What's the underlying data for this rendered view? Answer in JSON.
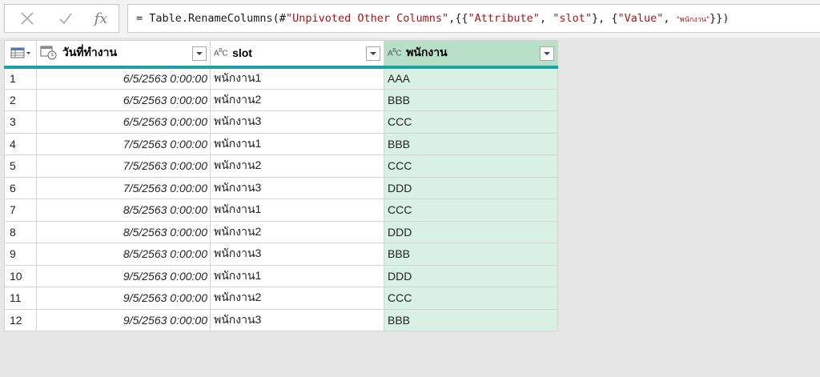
{
  "formula_bar": {
    "cancel_icon": "close-icon",
    "confirm_icon": "check-icon",
    "fx_label": "fx",
    "formula_prefix": "= Table.RenameColumns(#",
    "formula_step": "\"Unpivoted Other Columns\"",
    "formula_mid1": ",{{",
    "formula_attr": "\"Attribute\"",
    "formula_sep1": ", ",
    "formula_slot": "\"slot\"",
    "formula_mid2": "}, {",
    "formula_value": "\"Value\"",
    "formula_sep2": ", ",
    "formula_emp": "\"พนักงาน\"",
    "formula_suffix": "}})"
  },
  "table": {
    "columns": [
      {
        "label": "วันที่ทำงาน",
        "type_icon": "datetime-icon"
      },
      {
        "label": "slot",
        "type_icon": "ABC"
      },
      {
        "label": "พนักงาน",
        "type_icon": "ABC"
      }
    ],
    "rows": [
      {
        "num": "1",
        "date": "6/5/2563 0:00:00",
        "slot": "พนักงาน1",
        "emp": "AAA"
      },
      {
        "num": "2",
        "date": "6/5/2563 0:00:00",
        "slot": "พนักงาน2",
        "emp": "BBB"
      },
      {
        "num": "3",
        "date": "6/5/2563 0:00:00",
        "slot": "พนักงาน3",
        "emp": "CCC"
      },
      {
        "num": "4",
        "date": "7/5/2563 0:00:00",
        "slot": "พนักงาน1",
        "emp": "BBB"
      },
      {
        "num": "5",
        "date": "7/5/2563 0:00:00",
        "slot": "พนักงาน2",
        "emp": "CCC"
      },
      {
        "num": "6",
        "date": "7/5/2563 0:00:00",
        "slot": "พนักงาน3",
        "emp": "DDD"
      },
      {
        "num": "7",
        "date": "8/5/2563 0:00:00",
        "slot": "พนักงาน1",
        "emp": "CCC"
      },
      {
        "num": "8",
        "date": "8/5/2563 0:00:00",
        "slot": "พนักงาน2",
        "emp": "DDD"
      },
      {
        "num": "9",
        "date": "8/5/2563 0:00:00",
        "slot": "พนักงาน3",
        "emp": "BBB"
      },
      {
        "num": "10",
        "date": "9/5/2563 0:00:00",
        "slot": "พนักงาน1",
        "emp": "DDD"
      },
      {
        "num": "11",
        "date": "9/5/2563 0:00:00",
        "slot": "พนักงาน2",
        "emp": "CCC"
      },
      {
        "num": "12",
        "date": "9/5/2563 0:00:00",
        "slot": "พนักงาน3",
        "emp": "BBB"
      }
    ]
  },
  "colors": {
    "selected_column_bg": "#d9f1e4",
    "header_underline": "#1aa3a3"
  }
}
